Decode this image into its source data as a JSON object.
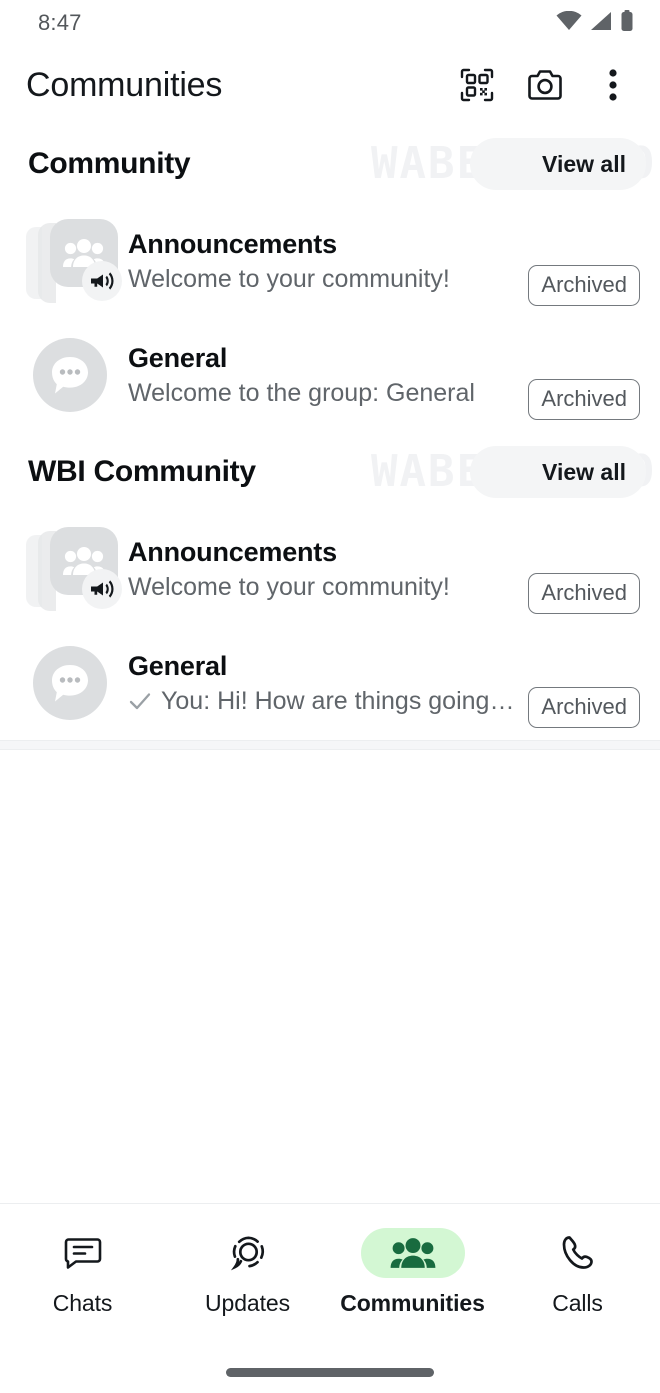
{
  "status_bar": {
    "time": "8:47",
    "icons": [
      "wifi-icon",
      "cellular-signal-icon",
      "battery-icon"
    ]
  },
  "app_bar": {
    "title": "Communities",
    "actions": [
      {
        "name": "qr-code-icon",
        "label": "QR code"
      },
      {
        "name": "camera-icon",
        "label": "Camera"
      },
      {
        "name": "overflow-menu-icon",
        "label": "More options"
      }
    ]
  },
  "watermark": {
    "text": "WABETAINFO"
  },
  "colors": {
    "accent_pill": "#d3f7d3",
    "accent_icon": "#186b3f",
    "title": "#0c0f12",
    "subtitle": "#60656a",
    "badge_border": "#74797e",
    "avatar_bg": "#dcdee0"
  },
  "communities": [
    {
      "name": "Community",
      "view_all_label": "View all",
      "chats": [
        {
          "title": "Announcements",
          "subtitle": "Welcome to your community!",
          "badge": "Archived",
          "avatar": "announcement-group-avatar",
          "has_megaphone_badge": true,
          "has_check": false
        },
        {
          "title": "General",
          "subtitle": "Welcome to the group: General",
          "badge": "Archived",
          "avatar": "group-chat-avatar",
          "has_megaphone_badge": false,
          "has_check": false
        }
      ]
    },
    {
      "name": "WBI Community",
      "view_all_label": "View all",
      "chats": [
        {
          "title": "Announcements",
          "subtitle": "Welcome to your community!",
          "badge": "Archived",
          "avatar": "announcement-group-avatar",
          "has_megaphone_badge": true,
          "has_check": false
        },
        {
          "title": "General",
          "subtitle": "You: Hi! How are things going…",
          "badge": "Archived",
          "avatar": "group-chat-avatar",
          "has_megaphone_badge": false,
          "has_check": true
        }
      ]
    }
  ],
  "bottom_nav": {
    "items": [
      {
        "label": "Chats",
        "icon": "chats-icon",
        "active": false
      },
      {
        "label": "Updates",
        "icon": "updates-icon",
        "active": false
      },
      {
        "label": "Communities",
        "icon": "communities-icon",
        "active": true
      },
      {
        "label": "Calls",
        "icon": "calls-icon",
        "active": false
      }
    ]
  }
}
